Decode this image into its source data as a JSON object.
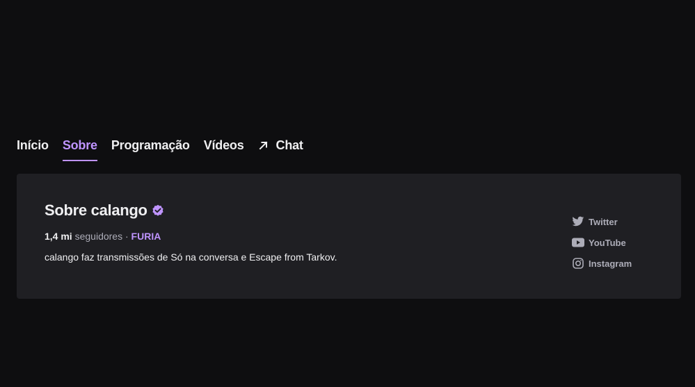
{
  "tabs": [
    {
      "label": "Início",
      "active": false
    },
    {
      "label": "Sobre",
      "active": true
    },
    {
      "label": "Programação",
      "active": false
    },
    {
      "label": "Vídeos",
      "active": false
    },
    {
      "label": "Chat",
      "active": false,
      "icon": "external-arrow-icon"
    }
  ],
  "about": {
    "title": "Sobre calango",
    "verified_icon": "verified-badge-icon",
    "followers_count": "1,4 mi",
    "followers_label": "seguidores",
    "separator": "·",
    "team": "FURIA",
    "description": "calango faz transmissões de Só na conversa e Escape from Tarkov."
  },
  "socials": [
    {
      "label": "Twitter",
      "icon": "twitter-icon"
    },
    {
      "label": "YouTube",
      "icon": "youtube-icon"
    },
    {
      "label": "Instagram",
      "icon": "instagram-icon"
    }
  ],
  "colors": {
    "background": "#0e0e10",
    "card": "#1f1f23",
    "accent": "#bf94ff",
    "text": "#efeff1",
    "muted": "#adadb8"
  }
}
